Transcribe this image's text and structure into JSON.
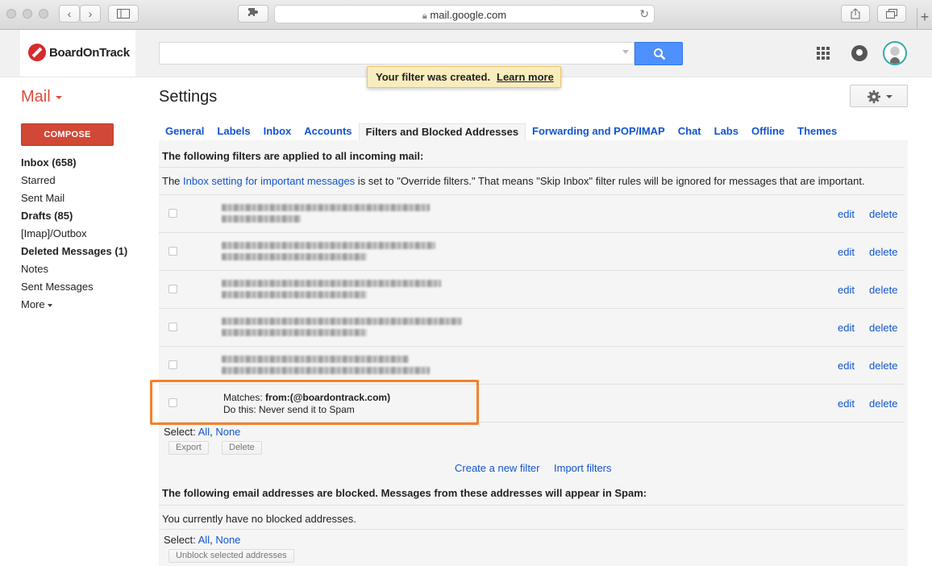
{
  "browser": {
    "url": "mail.google.com"
  },
  "header": {
    "brand": "BoardOnTrack",
    "search_value": "",
    "toast_message": "Your filter was created.",
    "toast_link": "Learn more"
  },
  "nav": {
    "mail_label": "Mail",
    "compose_label": "COMPOSE",
    "items": [
      {
        "label": "Inbox (658)"
      },
      {
        "label": "Starred"
      },
      {
        "label": "Sent Mail"
      },
      {
        "label": "Drafts (85)"
      },
      {
        "label": "[Imap]/Outbox"
      },
      {
        "label": "Deleted Messages (1)"
      },
      {
        "label": "Notes"
      },
      {
        "label": "Sent Messages"
      },
      {
        "label": "More"
      }
    ]
  },
  "page": {
    "title": "Settings",
    "tabs": [
      {
        "label": "General"
      },
      {
        "label": "Labels"
      },
      {
        "label": "Inbox"
      },
      {
        "label": "Accounts"
      },
      {
        "label": "Filters and Blocked Addresses"
      },
      {
        "label": "Forwarding and POP/IMAP"
      },
      {
        "label": "Chat"
      },
      {
        "label": "Labs"
      },
      {
        "label": "Offline"
      },
      {
        "label": "Themes"
      }
    ]
  },
  "filters": {
    "heading": "The following filters are applied to all incoming mail:",
    "note_prefix": "The ",
    "note_link": "Inbox setting for important messages",
    "note_suffix": " is set to \"Override filters.\" That means \"Skip Inbox\" filter rules will be ignored for messages that are important.",
    "edit_label": "edit",
    "delete_label": "delete",
    "new_filter": {
      "matches_label": "Matches: ",
      "matches_value": "from:(@boardontrack.com)",
      "action": "Do this: Never send it to Spam"
    },
    "select_label": "Select: ",
    "select_all": "All",
    "select_sep": ", ",
    "select_none": "None",
    "export_label": "Export",
    "delete_button": "Delete",
    "create_filter": "Create a new filter",
    "import_filters": "Import filters"
  },
  "blocked": {
    "heading": "The following email addresses are blocked. Messages from these addresses will appear in Spam:",
    "empty_text": "You currently have no blocked addresses.",
    "select_label": "Select: ",
    "select_all": "All",
    "select_sep": ", ",
    "select_none": "None",
    "unblock_label": "Unblock selected addresses"
  }
}
